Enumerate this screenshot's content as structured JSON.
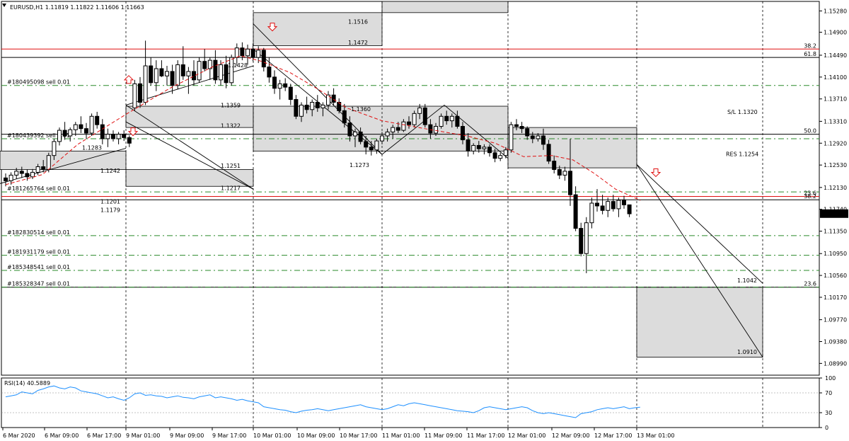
{
  "chart_data": {
    "type": "candlestick",
    "title": "EURUSD,H1  1.11819 1.11822 1.11606 1.11663",
    "symbol": "EURUSD",
    "timeframe": "H1",
    "ohlc": {
      "open": 1.11819,
      "high": 1.11822,
      "low": 1.11606,
      "close": 1.11663
    },
    "current_price_label": "1.11663",
    "price_axis": {
      "ylim": [
        1.0878,
        1.1545
      ],
      "ticks": [
        "1.15280",
        "1.14900",
        "1.14490",
        "1.14100",
        "1.13710",
        "1.13310",
        "1.12920",
        "1.12530",
        "1.12130",
        "1.11740",
        "1.11350",
        "1.10950",
        "1.10560",
        "1.10170",
        "1.09770",
        "1.09380",
        "1.08990"
      ]
    },
    "time_axis": {
      "ticks": [
        "6 Mar 2020",
        "6 Mar 09:00",
        "6 Mar 17:00",
        "9 Mar 01:00",
        "9 Mar 09:00",
        "9 Mar 17:00",
        "10 Mar 01:00",
        "10 Mar 09:00",
        "10 Mar 17:00",
        "11 Mar 01:00",
        "11 Mar 09:00",
        "11 Mar 17:00",
        "12 Mar 01:00",
        "12 Mar 09:00",
        "12 Mar 17:00",
        "13 Mar 01:00"
      ],
      "separators": [
        "9 Mar 01:00",
        "10 Mar 01:00",
        "10 Mar 17:00",
        "11 Mar 17:00",
        "12 Mar 17:00",
        "13 Mar 01:00"
      ]
    },
    "candles": [
      [
        1.123,
        1.1238,
        1.1215,
        1.1225
      ],
      [
        1.1225,
        1.124,
        1.1218,
        1.1235
      ],
      [
        1.1235,
        1.1248,
        1.1228,
        1.1242
      ],
      [
        1.1242,
        1.125,
        1.123,
        1.1238
      ],
      [
        1.1238,
        1.1245,
        1.1225,
        1.1232
      ],
      [
        1.1232,
        1.1246,
        1.1228,
        1.124
      ],
      [
        1.124,
        1.1255,
        1.1235,
        1.125
      ],
      [
        1.125,
        1.1262,
        1.124,
        1.1245
      ],
      [
        1.1245,
        1.1275,
        1.124,
        1.127
      ],
      [
        1.127,
        1.13,
        1.1262,
        1.1295
      ],
      [
        1.1295,
        1.132,
        1.1288,
        1.1315
      ],
      [
        1.1315,
        1.133,
        1.1298,
        1.1305
      ],
      [
        1.1305,
        1.132,
        1.1295,
        1.1316
      ],
      [
        1.1316,
        1.133,
        1.1305,
        1.1325
      ],
      [
        1.1325,
        1.134,
        1.131,
        1.1318
      ],
      [
        1.1318,
        1.1328,
        1.13,
        1.131
      ],
      [
        1.131,
        1.1345,
        1.1305,
        1.134
      ],
      [
        1.134,
        1.1348,
        1.1318,
        1.1325
      ],
      [
        1.1325,
        1.1335,
        1.129,
        1.13
      ],
      [
        1.13,
        1.1318,
        1.1285,
        1.1308
      ],
      [
        1.1308,
        1.1315,
        1.1295,
        1.13
      ],
      [
        1.13,
        1.1312,
        1.129,
        1.1308
      ],
      [
        1.1308,
        1.1315,
        1.1296,
        1.1302
      ],
      [
        1.1302,
        1.1306,
        1.1285,
        1.1292
      ],
      [
        1.1355,
        1.1405,
        1.135,
        1.1398
      ],
      [
        1.1398,
        1.141,
        1.1355,
        1.1365
      ],
      [
        1.1365,
        1.1475,
        1.136,
        1.143
      ],
      [
        1.143,
        1.1445,
        1.1395,
        1.14
      ],
      [
        1.14,
        1.144,
        1.1385,
        1.1425
      ],
      [
        1.1425,
        1.144,
        1.141,
        1.1412
      ],
      [
        1.1412,
        1.143,
        1.1395,
        1.142
      ],
      [
        1.142,
        1.1432,
        1.138,
        1.1395
      ],
      [
        1.1395,
        1.144,
        1.1388,
        1.1432
      ],
      [
        1.1432,
        1.1465,
        1.1405,
        1.1412
      ],
      [
        1.1412,
        1.1428,
        1.138,
        1.142
      ],
      [
        1.142,
        1.144,
        1.1395,
        1.1405
      ],
      [
        1.1405,
        1.1445,
        1.14,
        1.1438
      ],
      [
        1.1438,
        1.146,
        1.142,
        1.1425
      ],
      [
        1.1425,
        1.1445,
        1.1405,
        1.144
      ],
      [
        1.144,
        1.1458,
        1.1398,
        1.1405
      ],
      [
        1.1405,
        1.144,
        1.1395,
        1.1432
      ],
      [
        1.1432,
        1.1448,
        1.139,
        1.14
      ],
      [
        1.14,
        1.145,
        1.1395,
        1.1445
      ],
      [
        1.1445,
        1.147,
        1.143,
        1.1462
      ],
      [
        1.1462,
        1.1472,
        1.144,
        1.1448
      ],
      [
        1.1448,
        1.1468,
        1.1432,
        1.146
      ],
      [
        1.146,
        1.147,
        1.1438,
        1.1445
      ],
      [
        1.1445,
        1.1465,
        1.1435,
        1.1458
      ],
      [
        1.1458,
        1.1462,
        1.142,
        1.1428
      ],
      [
        1.1428,
        1.1445,
        1.14,
        1.141
      ],
      [
        1.141,
        1.1422,
        1.138,
        1.139
      ],
      [
        1.139,
        1.1405,
        1.137,
        1.1398
      ],
      [
        1.1398,
        1.1408,
        1.1385,
        1.1392
      ],
      [
        1.1392,
        1.1398,
        1.136,
        1.137
      ],
      [
        1.137,
        1.1378,
        1.1335,
        1.134
      ],
      [
        1.134,
        1.1365,
        1.133,
        1.136
      ],
      [
        1.136,
        1.1375,
        1.1345,
        1.1352
      ],
      [
        1.1352,
        1.137,
        1.134,
        1.1365
      ],
      [
        1.1365,
        1.1378,
        1.1348,
        1.1355
      ],
      [
        1.1355,
        1.1365,
        1.134,
        1.136
      ],
      [
        1.136,
        1.1385,
        1.1352,
        1.1378
      ],
      [
        1.1378,
        1.139,
        1.136,
        1.1365
      ],
      [
        1.1365,
        1.1372,
        1.1345,
        1.135
      ],
      [
        1.135,
        1.1362,
        1.132,
        1.1328
      ],
      [
        1.1328,
        1.134,
        1.1295,
        1.1305
      ],
      [
        1.1305,
        1.1318,
        1.1285,
        1.1312
      ],
      [
        1.1312,
        1.132,
        1.129,
        1.1295
      ],
      [
        1.1295,
        1.1305,
        1.1272,
        1.1285
      ],
      [
        1.1285,
        1.1296,
        1.127,
        1.128
      ],
      [
        1.128,
        1.13,
        1.1273,
        1.1296
      ],
      [
        1.1296,
        1.1312,
        1.129,
        1.1305
      ],
      [
        1.1305,
        1.1318,
        1.1295,
        1.1312
      ],
      [
        1.1312,
        1.1325,
        1.13,
        1.132
      ],
      [
        1.132,
        1.133,
        1.131,
        1.1315
      ],
      [
        1.1315,
        1.1335,
        1.1312,
        1.133
      ],
      [
        1.133,
        1.134,
        1.1318,
        1.1325
      ],
      [
        1.1325,
        1.135,
        1.132,
        1.1345
      ],
      [
        1.1345,
        1.1362,
        1.1335,
        1.1355
      ],
      [
        1.1355,
        1.1362,
        1.132,
        1.1325
      ],
      [
        1.1325,
        1.1335,
        1.13,
        1.131
      ],
      [
        1.131,
        1.1328,
        1.1305,
        1.1322
      ],
      [
        1.1322,
        1.1345,
        1.1318,
        1.134
      ],
      [
        1.134,
        1.135,
        1.1325,
        1.1332
      ],
      [
        1.1332,
        1.1345,
        1.132,
        1.134
      ],
      [
        1.134,
        1.135,
        1.1318,
        1.1322
      ],
      [
        1.1322,
        1.133,
        1.129,
        1.1298
      ],
      [
        1.1298,
        1.131,
        1.1268,
        1.1278
      ],
      [
        1.1278,
        1.1292,
        1.1272,
        1.1288
      ],
      [
        1.1288,
        1.1296,
        1.1275,
        1.1282
      ],
      [
        1.1282,
        1.129,
        1.1272,
        1.1285
      ],
      [
        1.1285,
        1.129,
        1.1268,
        1.1275
      ],
      [
        1.1275,
        1.1282,
        1.1258,
        1.1265
      ],
      [
        1.1265,
        1.1275,
        1.126,
        1.127
      ],
      [
        1.127,
        1.1285,
        1.1265,
        1.128
      ],
      [
        1.128,
        1.133,
        1.1275,
        1.1325
      ],
      [
        1.1325,
        1.1335,
        1.1315,
        1.1322
      ],
      [
        1.1322,
        1.133,
        1.131,
        1.1318
      ],
      [
        1.1318,
        1.1322,
        1.1298,
        1.1305
      ],
      [
        1.1305,
        1.1312,
        1.1292,
        1.13
      ],
      [
        1.13,
        1.131,
        1.1295,
        1.1305
      ],
      [
        1.1305,
        1.1318,
        1.128,
        1.129
      ],
      [
        1.129,
        1.1298,
        1.1255,
        1.126
      ],
      [
        1.126,
        1.127,
        1.1238,
        1.1245
      ],
      [
        1.1245,
        1.1252,
        1.1228,
        1.1235
      ],
      [
        1.1235,
        1.125,
        1.1225,
        1.1242
      ],
      [
        1.1242,
        1.13,
        1.118,
        1.12
      ],
      [
        1.12,
        1.1215,
        1.1135,
        1.114
      ],
      [
        1.114,
        1.115,
        1.109,
        1.1095
      ],
      [
        1.1095,
        1.116,
        1.106,
        1.115
      ],
      [
        1.115,
        1.1195,
        1.114,
        1.1185
      ],
      [
        1.1185,
        1.121,
        1.117,
        1.118
      ],
      [
        1.118,
        1.12,
        1.1165,
        1.1172
      ],
      [
        1.1172,
        1.1195,
        1.116,
        1.1188
      ],
      [
        1.1188,
        1.12,
        1.117,
        1.1175
      ],
      [
        1.1175,
        1.1195,
        1.116,
        1.119
      ],
      [
        1.119,
        1.1198,
        1.1175,
        1.1182
      ],
      [
        1.1182,
        1.1182,
        1.116,
        1.1166
      ]
    ],
    "candle_x_start": 8,
    "candle_x_step": 7.6,
    "moving_average": [
      [
        8,
        1.1218
      ],
      [
        60,
        1.1236
      ],
      [
        110,
        1.129
      ],
      [
        180,
        1.1345
      ],
      [
        240,
        1.139
      ],
      [
        300,
        1.1428
      ],
      [
        340,
        1.1448
      ],
      [
        370,
        1.1438
      ],
      [
        410,
        1.1418
      ],
      [
        450,
        1.1388
      ],
      [
        490,
        1.1355
      ],
      [
        540,
        1.1332
      ],
      [
        600,
        1.1318
      ],
      [
        660,
        1.1305
      ],
      [
        700,
        1.1292
      ],
      [
        740,
        1.1268
      ],
      [
        780,
        1.127
      ],
      [
        810,
        1.1262
      ],
      [
        840,
        1.1238
      ],
      [
        870,
        1.121
      ],
      [
        905,
        1.119
      ]
    ],
    "horizontal_lines": [
      {
        "y": 1.146,
        "color": "#e01010",
        "label": "38.2"
      },
      {
        "y": 1.1445,
        "color": "#000000",
        "label": "61.8"
      },
      {
        "y": 1.1308,
        "color": "#000000",
        "label": "50.0"
      },
      {
        "y": 1.1197,
        "color": "#e01010",
        "label": "23.6"
      },
      {
        "y": 1.1191,
        "color": "#000000",
        "label": "38.2"
      },
      {
        "y": 1.1035,
        "color": "#000000",
        "label": "23.6"
      }
    ],
    "order_lines": [
      {
        "y": 1.1395,
        "label": "#180495098 sell 0.01"
      },
      {
        "y": 1.13,
        "label": "#180439392 sell 0.01"
      },
      {
        "y": 1.1205,
        "label": "#181265764 sell 0.01"
      },
      {
        "y": 1.1127,
        "label": "#182830514 sell 0.01"
      },
      {
        "y": 1.1092,
        "label": "#181931179 sell 0.01"
      },
      {
        "y": 1.1065,
        "label": "#185348541 sell 0.01"
      },
      {
        "y": 1.1035,
        "label": "#185328347 sell 0.01"
      }
    ],
    "level_labels": [
      {
        "text": "1.1516",
        "y": 1.1509
      },
      {
        "text": "1.1472",
        "y": 1.1472
      },
      {
        "text": "1.1428",
        "y": 1.1431
      },
      {
        "text": "1.1359",
        "y": 1.136
      },
      {
        "text": "1.1360",
        "y": 1.1353
      },
      {
        "text": "1.1322",
        "y": 1.1323
      },
      {
        "text": "1.1283",
        "y": 1.1284
      },
      {
        "text": "1.1273",
        "y": 1.1253
      },
      {
        "text": "1.1251",
        "y": 1.1252
      },
      {
        "text": "1.1242",
        "y": 1.1243
      },
      {
        "text": "1.1217",
        "y": 1.1212
      },
      {
        "text": "1.1201",
        "y": 1.1188
      },
      {
        "text": "1.1179",
        "y": 1.1173
      },
      {
        "text": "S/L 1.1320",
        "y": 1.1348
      },
      {
        "text": "RES 1.1254",
        "y": 1.1273
      },
      {
        "text": "1.1042",
        "y": 1.1047
      },
      {
        "text": "1.0910",
        "y": 1.092
      }
    ],
    "zones": [
      {
        "x": [
          0,
          178
        ],
        "y": [
          1.1245,
          1.1278
        ]
      },
      {
        "x": [
          178,
          358
        ],
        "y": [
          1.1215,
          1.1245
        ]
      },
      {
        "x": [
          178,
          358
        ],
        "y": [
          1.132,
          1.1358
        ]
      },
      {
        "x": [
          358,
          540
        ],
        "y": [
          1.1466,
          1.1525
        ]
      },
      {
        "x": [
          540,
          718
        ],
        "y": [
          1.1525,
          1.16
        ]
      },
      {
        "x": [
          358,
          718
        ],
        "y": [
          1.1278,
          1.1358
        ]
      },
      {
        "x": [
          718,
          900
        ],
        "y": [
          1.1248,
          1.132
        ]
      },
      {
        "x": [
          900,
          1078
        ],
        "y": [
          1.091,
          1.1035
        ]
      }
    ],
    "rsi": {
      "label": "RSI(14) 40.5889",
      "period": 14,
      "value": 40.5889,
      "ylim": [
        0,
        100
      ],
      "ticks": [
        "100",
        "70",
        "30",
        "0"
      ],
      "values": [
        62,
        64,
        66,
        72,
        70,
        68,
        75,
        78,
        82,
        84,
        80,
        78,
        82,
        80,
        74,
        72,
        70,
        68,
        64,
        60,
        62,
        58,
        55,
        60,
        68,
        70,
        65,
        66,
        64,
        63,
        60,
        62,
        64,
        61,
        60,
        58,
        62,
        64,
        66,
        60,
        62,
        60,
        58,
        55,
        57,
        54,
        52,
        50,
        42,
        40,
        38,
        36,
        35,
        32,
        30,
        33,
        35,
        36,
        38,
        36,
        34,
        36,
        38,
        40,
        42,
        44,
        46,
        42,
        40,
        38,
        36,
        38,
        42,
        46,
        44,
        48,
        50,
        48,
        46,
        44,
        42,
        40,
        38,
        36,
        34,
        33,
        32,
        30,
        34,
        40,
        42,
        40,
        38,
        36,
        38,
        40,
        42,
        40,
        34,
        30,
        28,
        30,
        28,
        26,
        24,
        22,
        20,
        28,
        30,
        32,
        36,
        38,
        40,
        38,
        40,
        42,
        38,
        40,
        41
      ]
    }
  }
}
